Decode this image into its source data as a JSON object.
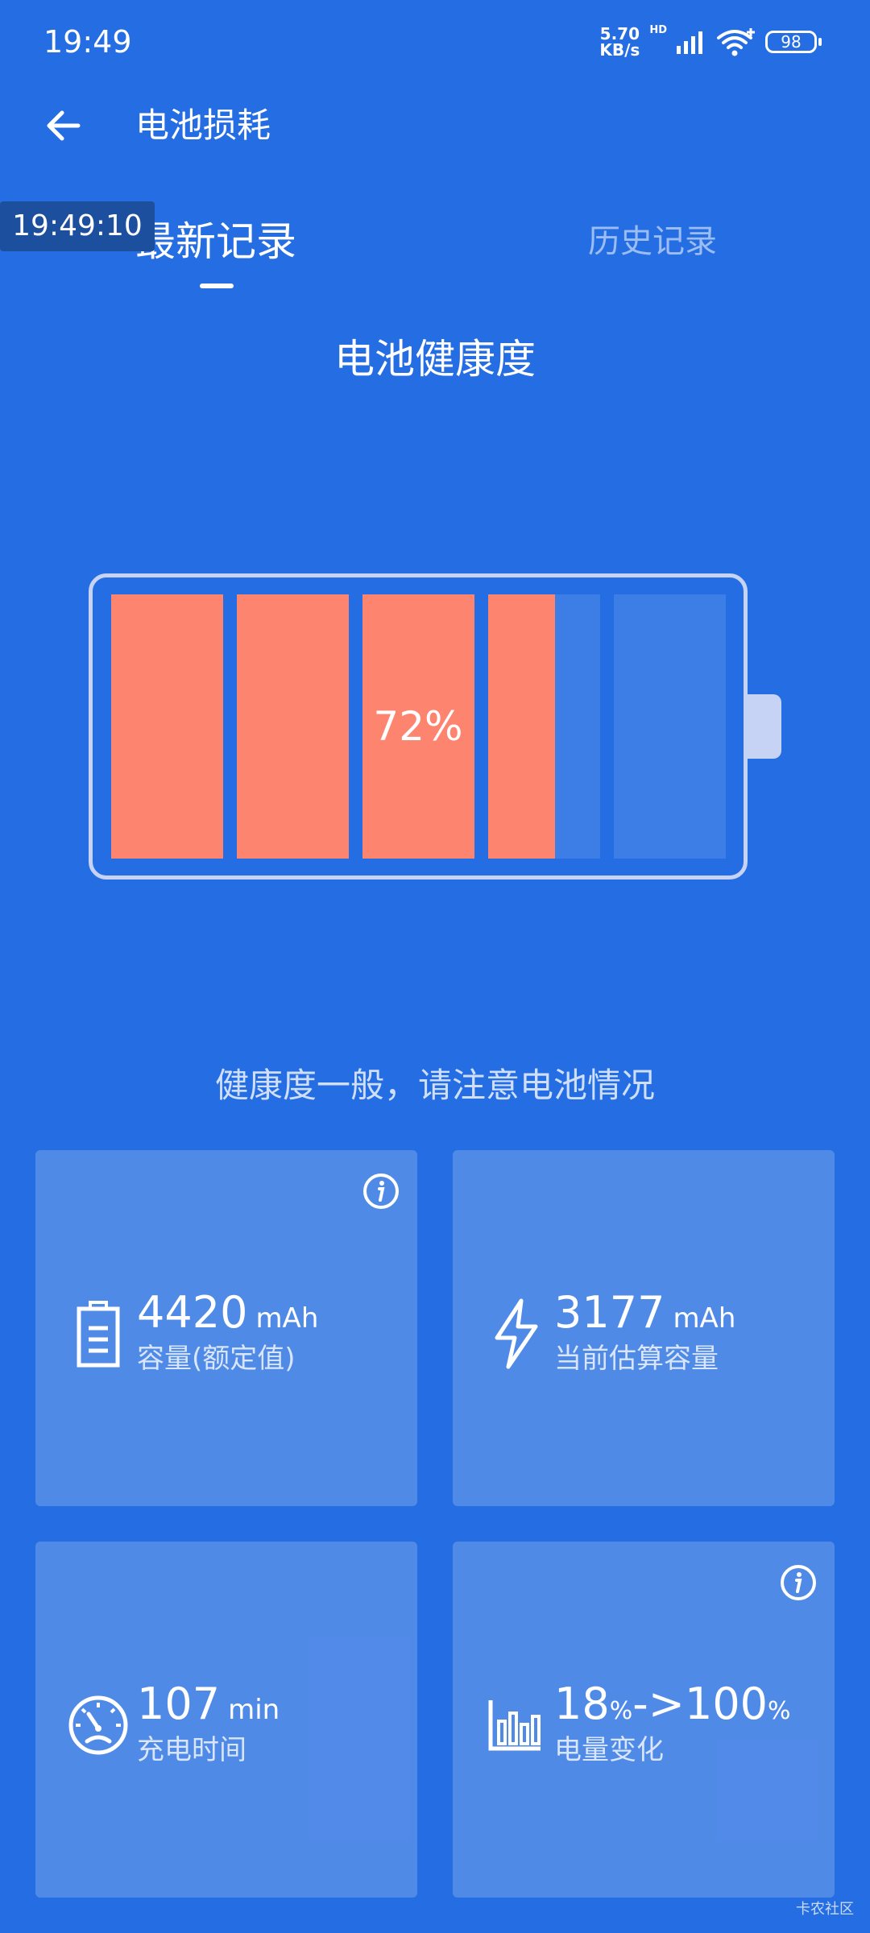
{
  "status_bar": {
    "time": "19:49",
    "net_speed_value": "5.70",
    "net_speed_unit": "KB/s",
    "network_type": "HD",
    "battery_level": "98"
  },
  "header": {
    "title": "电池损耗"
  },
  "timestamp_overlay": "19:49:10",
  "tabs": [
    {
      "label": "最新记录",
      "active": true
    },
    {
      "label": "历史记录",
      "active": false
    }
  ],
  "battery_health": {
    "title": "电池健康度",
    "percent_label": "72%",
    "percent_value": 72,
    "status_text": "健康度一般，请注意电池情况"
  },
  "cards": [
    {
      "icon": "battery-icon",
      "value": "4420",
      "unit": "mAh",
      "label": "容量(额定值)",
      "has_info": true
    },
    {
      "icon": "lightning-icon",
      "value": "3177",
      "unit": "mAh",
      "label": "当前估算容量",
      "has_info": false
    },
    {
      "icon": "speedometer-icon",
      "value": "107",
      "unit": "min",
      "label": "充电时间",
      "has_info": false
    },
    {
      "icon": "bar-chart-icon",
      "value_start": "18",
      "value_end": "100",
      "pct_symbol": "%",
      "arrow": "->",
      "label": "电量变化",
      "has_info": true
    }
  ],
  "watermark": "卡农社区",
  "colors": {
    "background": "#256DE2",
    "fill": "#FD8570",
    "empty_cell": "#3D7DE6",
    "outline": "#C6D3F4"
  }
}
